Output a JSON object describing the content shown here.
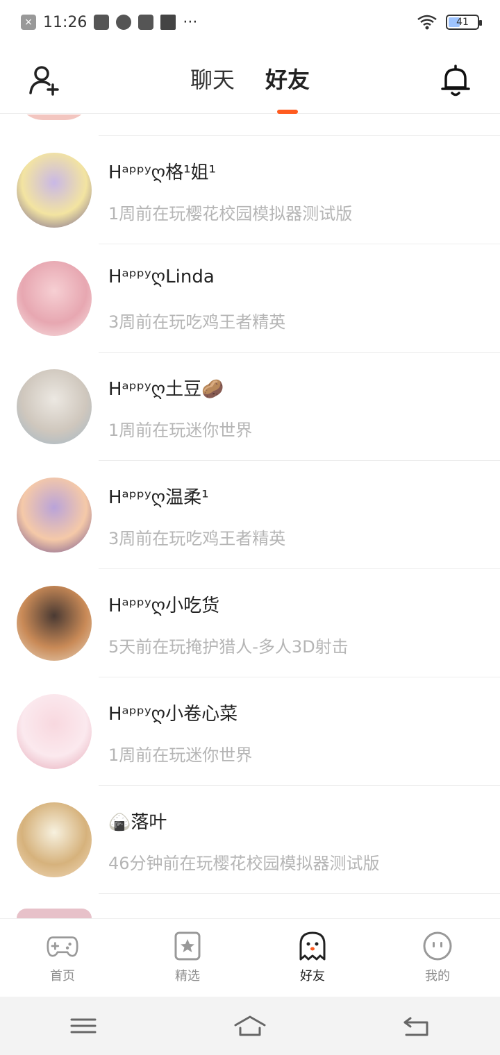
{
  "status_bar": {
    "time": "11:26",
    "more": "···",
    "battery": "41",
    "battery_level": 0.41
  },
  "header": {
    "tabs": [
      {
        "label": "聊天",
        "active": false
      },
      {
        "label": "好友",
        "active": true
      }
    ],
    "accent_color": "#ff5b1f"
  },
  "friends": [
    {
      "name": "Hᵃᵖᵖʸღ格¹姐¹",
      "status": "1周前在玩樱花校园模拟器测试版",
      "avatar_colors": [
        "#c9b8e6",
        "#f3e4a1",
        "#6b5a8e"
      ]
    },
    {
      "name": "HᵃᵖᵖʸღLinda",
      "status": "3周前在玩吃鸡王者精英",
      "avatar_colors": [
        "#f6cfd3",
        "#e7a7b1",
        "#f9e7e7"
      ]
    },
    {
      "name": "Hᵃᵖᵖʸღ土豆🥔",
      "status": "1周前在玩迷你世界",
      "avatar_colors": [
        "#ece8e2",
        "#cfc7bd",
        "#9fb6c7"
      ]
    },
    {
      "name": "Hᵃᵖᵖʸღ温柔¹",
      "status": "3周前在玩吃鸡王者精英",
      "avatar_colors": [
        "#b9a3d9",
        "#f5c9a8",
        "#6a4c8c"
      ]
    },
    {
      "name": "Hᵃᵖᵖʸღ小吃货",
      "status": "5天前在玩掩护猎人-多人3D射击",
      "avatar_colors": [
        "#4a3a33",
        "#c98a57",
        "#e9d7c1"
      ]
    },
    {
      "name": "Hᵃᵖᵖʸღ小卷心菜",
      "status": "1周前在玩迷你世界",
      "avatar_colors": [
        "#f8d8df",
        "#fbe9ee",
        "#e4a5b4"
      ]
    },
    {
      "name": "🍙落叶",
      "status": "46分钟前在玩樱花校园模拟器测试版",
      "avatar_colors": [
        "#f7f1df",
        "#d6b27c",
        "#f2dcc0"
      ]
    }
  ],
  "bottom_nav": {
    "items": [
      {
        "label": "首页",
        "icon": "gamepad-icon",
        "active": false
      },
      {
        "label": "精选",
        "icon": "star-card-icon",
        "active": false
      },
      {
        "label": "好友",
        "icon": "ghost-icon",
        "active": true
      },
      {
        "label": "我的",
        "icon": "face-icon",
        "active": false
      }
    ]
  },
  "system_nav": {
    "menu": "menu-icon",
    "home": "home-icon",
    "back": "back-icon"
  }
}
